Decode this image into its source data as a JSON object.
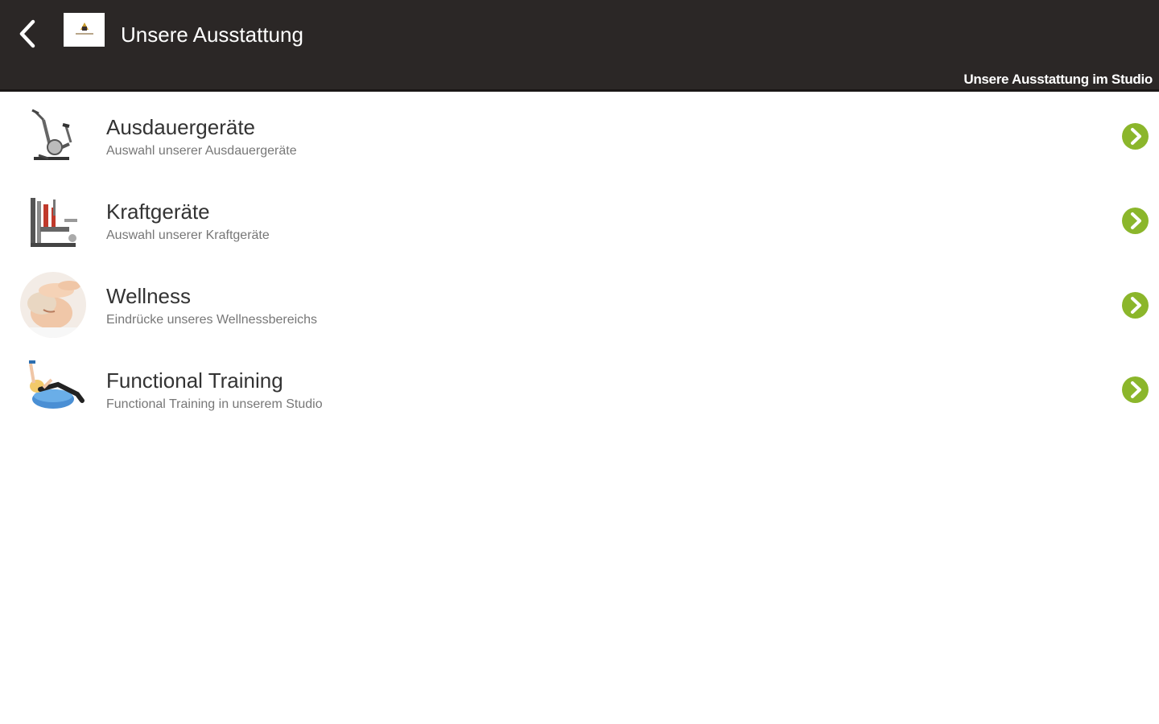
{
  "header": {
    "title": "Unsere Ausstattung",
    "subtitle": "Unsere Ausstattung im Studio",
    "back_icon": "chevron-left-icon",
    "background_color": "#2b2726"
  },
  "items": [
    {
      "title": "Ausdauergeräte",
      "subtitle": "Auswahl unserer Ausdauergeräte",
      "thumbnail": "exercise-bike-image"
    },
    {
      "title": "Kraftgeräte",
      "subtitle": "Auswahl unserer Kraftgeräte",
      "thumbnail": "strength-machine-image"
    },
    {
      "title": "Wellness",
      "subtitle": "Eindrücke unseres Wellnessbereichs",
      "thumbnail": "massage-image"
    },
    {
      "title": "Functional Training",
      "subtitle": "Functional Training in unserem Studio",
      "thumbnail": "balance-ball-workout-image"
    }
  ],
  "accent_color": "#8bb62b",
  "chevron_icon": "chevron-right-circle-icon"
}
